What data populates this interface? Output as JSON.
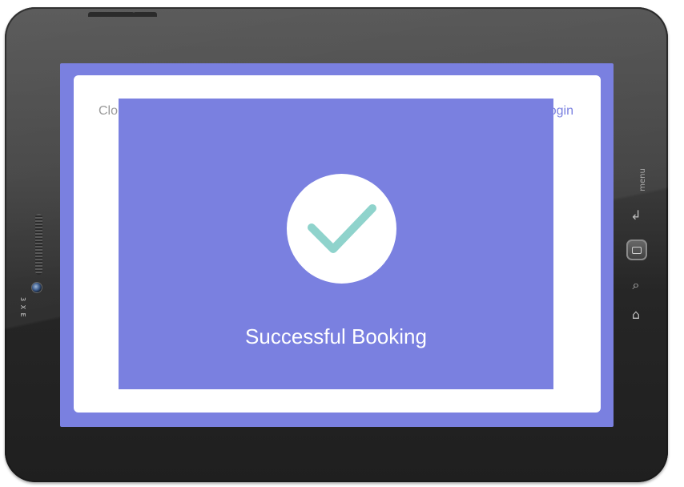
{
  "device": {
    "brand_mark": "3 X E",
    "menu_label": "menu",
    "keys": {
      "back_icon": "↲",
      "search_icon": "⌕",
      "home_icon": "⌂"
    }
  },
  "header": {
    "close_label": "Clo",
    "login_label": "ogin"
  },
  "modal": {
    "icon": "checkmark-icon",
    "message": "Successful Booking"
  },
  "colors": {
    "accent": "#7a80e0",
    "check": "#8fd3cc",
    "panel": "#ffffff"
  }
}
